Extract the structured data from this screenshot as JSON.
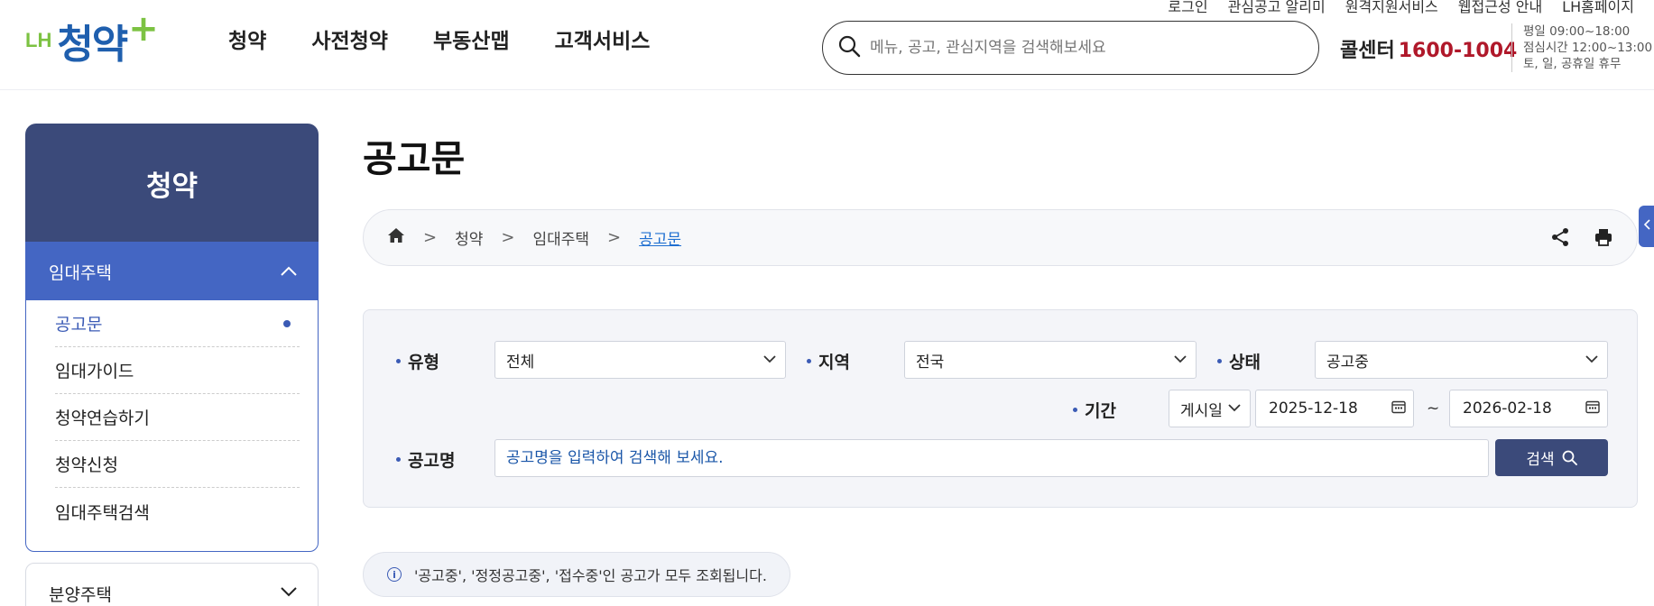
{
  "logo": {
    "prefix": "LH",
    "main": "청약",
    "plus": "+"
  },
  "gnb": [
    "청약",
    "사전청약",
    "부동산맵",
    "고객서비스"
  ],
  "util_links": [
    "로그인",
    "관심공고 알리미",
    "원격지원서비스",
    "웹접근성 안내",
    "LH홈페이지"
  ],
  "search": {
    "placeholder": "메뉴, 공고, 관심지역을 검색해보세요"
  },
  "callcenter": {
    "label": "콜센터",
    "number": "1600-1004"
  },
  "hours": [
    "평일 09:00~18:00",
    "점심시간 12:00~13:00",
    "토, 일, 공휴일 휴무"
  ],
  "sidebar": {
    "title": "청약",
    "group1": {
      "label": "임대주택",
      "items": [
        {
          "label": "공고문",
          "active": true
        },
        {
          "label": "임대가이드"
        },
        {
          "label": "청약연습하기"
        },
        {
          "label": "청약신청"
        },
        {
          "label": "임대주택검색"
        }
      ]
    },
    "group2": {
      "label": "분양주택"
    }
  },
  "page_title": "공고문",
  "breadcrumb": [
    "청약",
    "임대주택",
    "공고문"
  ],
  "filter": {
    "type_label": "유형",
    "type_value": "전체",
    "region_label": "지역",
    "region_value": "전국",
    "status_label": "상태",
    "status_value": "공고중",
    "period_label": "기간",
    "period_type": "게시일",
    "date_from": "2025-12-18",
    "date_to": "2026-02-18",
    "tilde": "~",
    "name_label": "공고명",
    "name_placeholder": "공고명을 입력하여 검색해 보세요.",
    "search_button": "검색"
  },
  "notice": "'공고중', '정정공고중', '접수중'인 공고가 모두 조회됩니다.",
  "colors": {
    "navy": "#3b4a7a",
    "blue": "#4466c3",
    "red": "#b0182a",
    "green": "#7cc242"
  }
}
